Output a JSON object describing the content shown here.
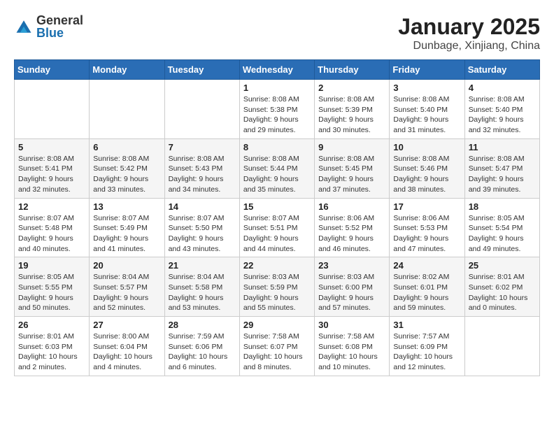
{
  "logo": {
    "general": "General",
    "blue": "Blue"
  },
  "title": "January 2025",
  "location": "Dunbage, Xinjiang, China",
  "days_of_week": [
    "Sunday",
    "Monday",
    "Tuesday",
    "Wednesday",
    "Thursday",
    "Friday",
    "Saturday"
  ],
  "weeks": [
    [
      {
        "day": "",
        "info": ""
      },
      {
        "day": "",
        "info": ""
      },
      {
        "day": "",
        "info": ""
      },
      {
        "day": "1",
        "info": "Sunrise: 8:08 AM\nSunset: 5:38 PM\nDaylight: 9 hours and 29 minutes."
      },
      {
        "day": "2",
        "info": "Sunrise: 8:08 AM\nSunset: 5:39 PM\nDaylight: 9 hours and 30 minutes."
      },
      {
        "day": "3",
        "info": "Sunrise: 8:08 AM\nSunset: 5:40 PM\nDaylight: 9 hours and 31 minutes."
      },
      {
        "day": "4",
        "info": "Sunrise: 8:08 AM\nSunset: 5:40 PM\nDaylight: 9 hours and 32 minutes."
      }
    ],
    [
      {
        "day": "5",
        "info": "Sunrise: 8:08 AM\nSunset: 5:41 PM\nDaylight: 9 hours and 32 minutes."
      },
      {
        "day": "6",
        "info": "Sunrise: 8:08 AM\nSunset: 5:42 PM\nDaylight: 9 hours and 33 minutes."
      },
      {
        "day": "7",
        "info": "Sunrise: 8:08 AM\nSunset: 5:43 PM\nDaylight: 9 hours and 34 minutes."
      },
      {
        "day": "8",
        "info": "Sunrise: 8:08 AM\nSunset: 5:44 PM\nDaylight: 9 hours and 35 minutes."
      },
      {
        "day": "9",
        "info": "Sunrise: 8:08 AM\nSunset: 5:45 PM\nDaylight: 9 hours and 37 minutes."
      },
      {
        "day": "10",
        "info": "Sunrise: 8:08 AM\nSunset: 5:46 PM\nDaylight: 9 hours and 38 minutes."
      },
      {
        "day": "11",
        "info": "Sunrise: 8:08 AM\nSunset: 5:47 PM\nDaylight: 9 hours and 39 minutes."
      }
    ],
    [
      {
        "day": "12",
        "info": "Sunrise: 8:07 AM\nSunset: 5:48 PM\nDaylight: 9 hours and 40 minutes."
      },
      {
        "day": "13",
        "info": "Sunrise: 8:07 AM\nSunset: 5:49 PM\nDaylight: 9 hours and 41 minutes."
      },
      {
        "day": "14",
        "info": "Sunrise: 8:07 AM\nSunset: 5:50 PM\nDaylight: 9 hours and 43 minutes."
      },
      {
        "day": "15",
        "info": "Sunrise: 8:07 AM\nSunset: 5:51 PM\nDaylight: 9 hours and 44 minutes."
      },
      {
        "day": "16",
        "info": "Sunrise: 8:06 AM\nSunset: 5:52 PM\nDaylight: 9 hours and 46 minutes."
      },
      {
        "day": "17",
        "info": "Sunrise: 8:06 AM\nSunset: 5:53 PM\nDaylight: 9 hours and 47 minutes."
      },
      {
        "day": "18",
        "info": "Sunrise: 8:05 AM\nSunset: 5:54 PM\nDaylight: 9 hours and 49 minutes."
      }
    ],
    [
      {
        "day": "19",
        "info": "Sunrise: 8:05 AM\nSunset: 5:55 PM\nDaylight: 9 hours and 50 minutes."
      },
      {
        "day": "20",
        "info": "Sunrise: 8:04 AM\nSunset: 5:57 PM\nDaylight: 9 hours and 52 minutes."
      },
      {
        "day": "21",
        "info": "Sunrise: 8:04 AM\nSunset: 5:58 PM\nDaylight: 9 hours and 53 minutes."
      },
      {
        "day": "22",
        "info": "Sunrise: 8:03 AM\nSunset: 5:59 PM\nDaylight: 9 hours and 55 minutes."
      },
      {
        "day": "23",
        "info": "Sunrise: 8:03 AM\nSunset: 6:00 PM\nDaylight: 9 hours and 57 minutes."
      },
      {
        "day": "24",
        "info": "Sunrise: 8:02 AM\nSunset: 6:01 PM\nDaylight: 9 hours and 59 minutes."
      },
      {
        "day": "25",
        "info": "Sunrise: 8:01 AM\nSunset: 6:02 PM\nDaylight: 10 hours and 0 minutes."
      }
    ],
    [
      {
        "day": "26",
        "info": "Sunrise: 8:01 AM\nSunset: 6:03 PM\nDaylight: 10 hours and 2 minutes."
      },
      {
        "day": "27",
        "info": "Sunrise: 8:00 AM\nSunset: 6:04 PM\nDaylight: 10 hours and 4 minutes."
      },
      {
        "day": "28",
        "info": "Sunrise: 7:59 AM\nSunset: 6:06 PM\nDaylight: 10 hours and 6 minutes."
      },
      {
        "day": "29",
        "info": "Sunrise: 7:58 AM\nSunset: 6:07 PM\nDaylight: 10 hours and 8 minutes."
      },
      {
        "day": "30",
        "info": "Sunrise: 7:58 AM\nSunset: 6:08 PM\nDaylight: 10 hours and 10 minutes."
      },
      {
        "day": "31",
        "info": "Sunrise: 7:57 AM\nSunset: 6:09 PM\nDaylight: 10 hours and 12 minutes."
      },
      {
        "day": "",
        "info": ""
      }
    ]
  ]
}
